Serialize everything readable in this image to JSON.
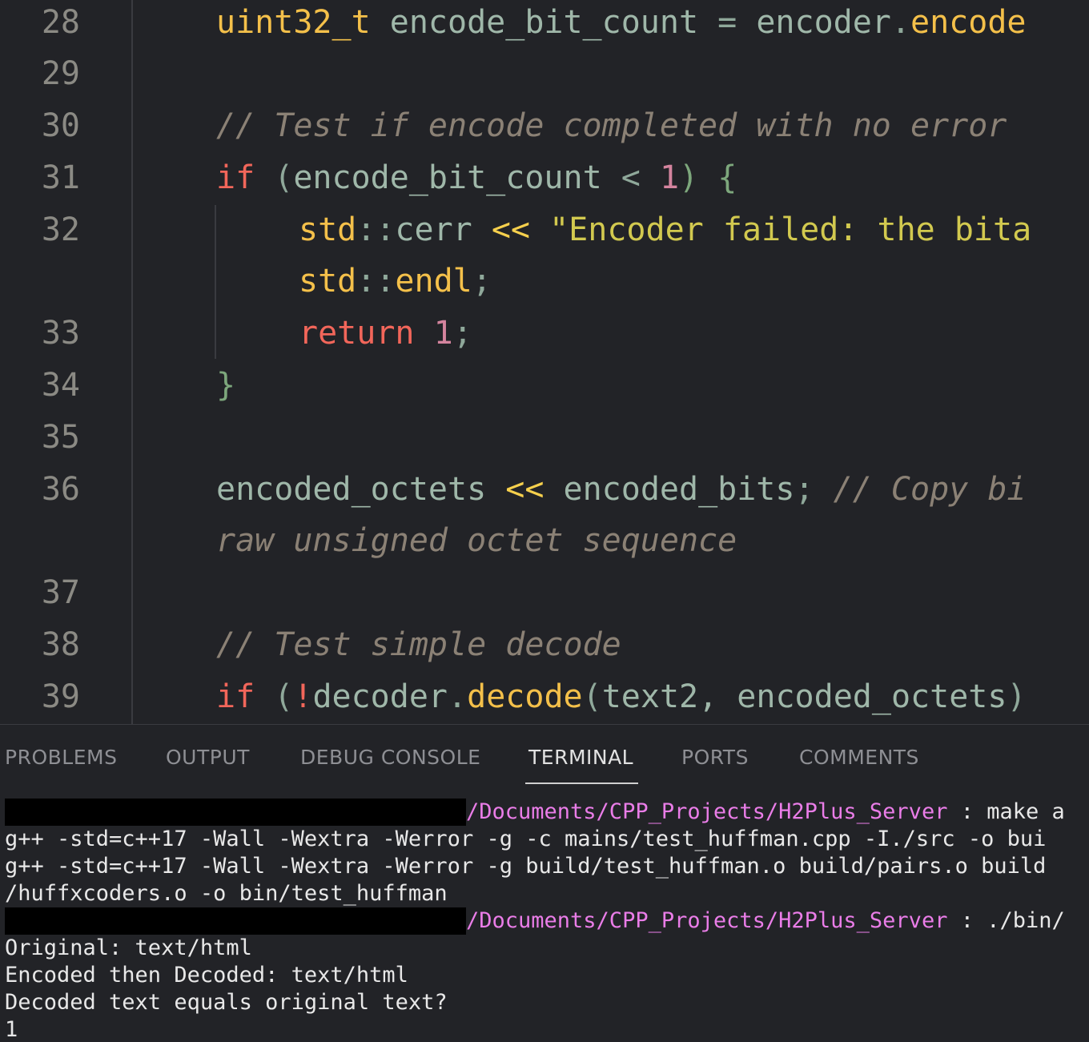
{
  "editor": {
    "lines": [
      {
        "num": "28",
        "parts": [
          {
            "t": "uint32_t",
            "c": "ty"
          },
          {
            "t": " encode_bit_count ",
            "c": ""
          },
          {
            "t": "=",
            "c": "pun"
          },
          {
            "t": " encoder",
            "c": ""
          },
          {
            "t": ".",
            "c": "pun"
          },
          {
            "t": "encode",
            "c": "fn"
          }
        ]
      },
      {
        "num": "29",
        "parts": []
      },
      {
        "num": "30",
        "parts": [
          {
            "t": "// Test if encode completed with no error",
            "c": "cm"
          }
        ]
      },
      {
        "num": "31",
        "parts": [
          {
            "t": "if",
            "c": "kw"
          },
          {
            "t": " (",
            "c": "pun"
          },
          {
            "t": "encode_bit_count ",
            "c": ""
          },
          {
            "t": "<",
            "c": "pun"
          },
          {
            "t": " ",
            "c": ""
          },
          {
            "t": "1",
            "c": "num"
          },
          {
            "t": ") {",
            "c": "br"
          }
        ]
      },
      {
        "num": "32",
        "parts": [
          {
            "t": "std",
            "c": "ty"
          },
          {
            "t": "::",
            "c": "pun"
          },
          {
            "t": "cerr ",
            "c": ""
          },
          {
            "t": "<<",
            "c": "op"
          },
          {
            "t": " \"Encoder failed: the bita",
            "c": "str"
          }
        ]
      },
      {
        "num": "",
        "parts": [
          {
            "t": "std",
            "c": "ty"
          },
          {
            "t": "::",
            "c": "pun"
          },
          {
            "t": "endl",
            "c": "fn"
          },
          {
            "t": ";",
            "c": "pun"
          }
        ]
      },
      {
        "num": "33",
        "parts": [
          {
            "t": "return",
            "c": "kw"
          },
          {
            "t": " ",
            "c": ""
          },
          {
            "t": "1",
            "c": "num"
          },
          {
            "t": ";",
            "c": "pun"
          }
        ]
      },
      {
        "num": "34",
        "parts": [
          {
            "t": "}",
            "c": "br"
          }
        ]
      },
      {
        "num": "35",
        "parts": []
      },
      {
        "num": "36",
        "parts": [
          {
            "t": "encoded_octets ",
            "c": ""
          },
          {
            "t": "<<",
            "c": "op"
          },
          {
            "t": " encoded_bits",
            "c": ""
          },
          {
            "t": ";",
            "c": "pun"
          },
          {
            "t": " // Copy bi",
            "c": "cm"
          }
        ]
      },
      {
        "num": "",
        "parts": [
          {
            "t": "raw unsigned octet sequence",
            "c": "cm"
          }
        ]
      },
      {
        "num": "37",
        "parts": []
      },
      {
        "num": "38",
        "parts": [
          {
            "t": "// Test simple decode",
            "c": "cm"
          }
        ]
      },
      {
        "num": "39",
        "parts": [
          {
            "t": "if",
            "c": "kw"
          },
          {
            "t": " (",
            "c": "pun"
          },
          {
            "t": "!",
            "c": "kw"
          },
          {
            "t": "decoder",
            "c": ""
          },
          {
            "t": ".",
            "c": "pun"
          },
          {
            "t": "decode",
            "c": "fn"
          },
          {
            "t": "(",
            "c": "pun"
          },
          {
            "t": "text2",
            "c": ""
          },
          {
            "t": ", encoded_octets",
            "c": ""
          },
          {
            "t": ")",
            "c": "pun"
          }
        ]
      }
    ]
  },
  "panel": {
    "tabs": [
      {
        "label": "PROBLEMS",
        "active": false
      },
      {
        "label": "OUTPUT",
        "active": false
      },
      {
        "label": "DEBUG CONSOLE",
        "active": false
      },
      {
        "label": "TERMINAL",
        "active": true
      },
      {
        "label": "PORTS",
        "active": false
      },
      {
        "label": "COMMENTS",
        "active": false
      }
    ],
    "terminal": {
      "prompt_path": "/Documents/CPP_Projects/H2Plus_Server",
      "cmd1": " : make a",
      "out1": "g++ -std=c++17 -Wall -Wextra -Werror -g -c mains/test_huffman.cpp -I./src -o bui",
      "out2": "g++ -std=c++17 -Wall -Wextra -Werror -g build/test_huffman.o build/pairs.o build",
      "out3": "/huffxcoders.o -o bin/test_huffman",
      "cmd2": " : ./bin/",
      "out4": "Original: text/html",
      "out5": "Encoded then Decoded: text/html",
      "out6": "Decoded text equals original text?",
      "out7": "1"
    }
  },
  "colors": {
    "path": "#ea7de8",
    "keyword": "#f2665a",
    "type": "#f4c04a",
    "comment": "#8b8175"
  }
}
